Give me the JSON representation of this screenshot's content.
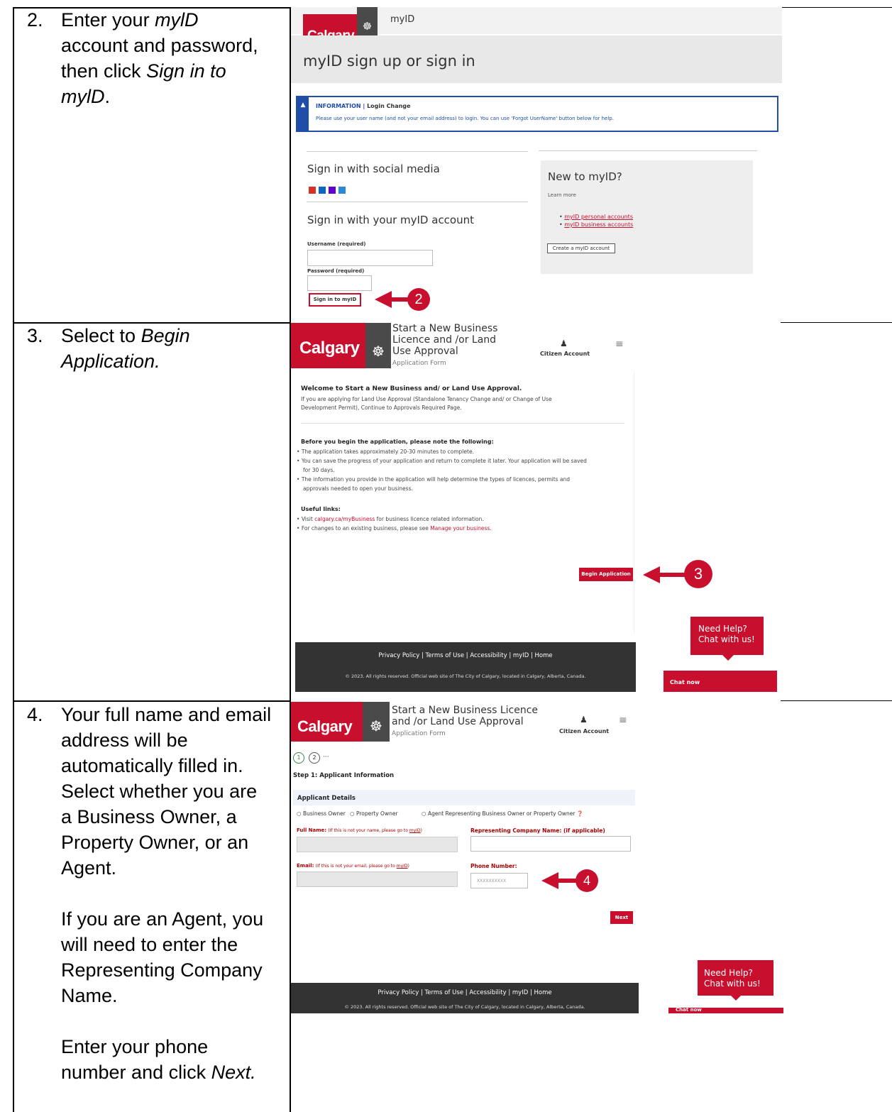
{
  "steps": [
    {
      "num": "2.",
      "lines": [
        [
          "Enter your ",
          "mylD",
          ""
        ],
        [
          "account and password,"
        ],
        [
          "then click ",
          "Sign in to",
          ""
        ],
        [
          "",
          "mylD",
          "."
        ]
      ]
    },
    {
      "num": "3.",
      "lines": [
        [
          "Select to ",
          "Begin",
          ""
        ],
        [
          "",
          "Application.",
          ""
        ]
      ]
    },
    {
      "num": "4.",
      "p1": [
        "Your full name and email",
        "address will be",
        "automatically filled in.",
        "Select whether you are",
        "a Business Owner, a",
        "Property Owner, or an",
        "Agent."
      ],
      "p2": [
        "If you are an Agent, you",
        "will need to enter the",
        "Representing Company",
        "Name."
      ],
      "p3a": "Enter your phone",
      "p3b": "number and click ",
      "p3c": "Next."
    }
  ],
  "s1": {
    "logo": "Calgary",
    "crest": "crest-icon",
    "brand": "myID",
    "heading": "myID sign up or sign in",
    "info_label": "INFORMATION",
    "info_sep": "|",
    "info_title": "Login Change",
    "info_text": "Please use your user name (and not your email address) to login. You can use 'Forgot UserName' button below for help.",
    "social_title": "Sign in with social media",
    "social_icons": [
      "google-icon",
      "linkedin-icon",
      "yahoo-icon",
      "microsoft-icon"
    ],
    "account_title": "Sign in with your myID account",
    "username_label": "Username (required)",
    "password_label": "Password (required)",
    "signin_button": "Sign in to myID",
    "badge": "2",
    "new_title": "New to myID?",
    "learn_more": "Learn more",
    "links": [
      "myID personal accounts",
      "myID business accounts"
    ],
    "create_button": "Create a myID account"
  },
  "s2": {
    "logo": "Calgary",
    "title": [
      "Start a New Business",
      "Licence and /or Land",
      "Use Approval"
    ],
    "subtitle": "Application Form",
    "account": "Citizen Account",
    "welcome": "Welcome to Start a New Business and/ or Land Use Approval.",
    "intro": [
      "If you are applying for Land Use Approval (Standalone Tenancy Change and/ or Change of Use",
      "Development Permit), Continue to Approvals Required Page."
    ],
    "before_title": "Before you begin the application, please note the following:",
    "b1": "The application takes approximately 20-30 minutes to complete.",
    "b2a": "You can save the progress of your application and return to complete it later. Your application will be saved",
    "b2b": "for 30 days.",
    "b3a": "The information you provide in the application will help determine the types of licences, permits and",
    "b3b": "approvals needed to open your business.",
    "useful_title": "Useful links:",
    "u1_pre": "Visit ",
    "u1_link": "calgary.ca/myBusiness",
    "u1_post": " for business licence related information.",
    "u2_pre": "For changes to an existing business, please see ",
    "u2_link": "Manage your business",
    "u2_post": ".",
    "begin_button": "Begin Application",
    "badge": "3",
    "footer_links": "Privacy Policy | Terms of Use | Accessibility | myID | Home",
    "footer_copy": "© 2023. All rights reserved. Official web site of The City of Calgary, located in Calgary, Alberta, Canada.",
    "help": [
      "Need Help?",
      "Chat with us!"
    ],
    "chat_now": "Chat now"
  },
  "s3": {
    "logo": "Calgary",
    "title": [
      "Start a New Business Licence",
      "and /or Land Use Approval"
    ],
    "subtitle": "Application Form",
    "account": "Citizen Account",
    "steps": [
      "1",
      "2",
      "···"
    ],
    "step_title": "Step 1: Applicant Information",
    "section": "Applicant Details",
    "radios": [
      "Business Owner",
      "Property Owner",
      "Agent Representing Business Owner or Property Owner"
    ],
    "fullname_label": "Full Name:",
    "fullname_note": "(If this is not your name, please go to ",
    "myid_link": "myID",
    "note_close": ")",
    "company_label": "Representing Company Name: (if applicable)",
    "email_label": "Email:",
    "email_note": "(If this is not your email, please go to ",
    "phone_label": "Phone Number:",
    "phone_placeholder": "XXXXXXXXXX",
    "next_button": "Next",
    "badge": "4",
    "footer_links": "Privacy Policy | Terms of Use | Accessibility | myID | Home",
    "footer_copy": "© 2023. All rights reserved. Official web site of The City of Calgary, located in Calgary, Alberta, Canada.",
    "help": [
      "Need Help?",
      "Chat with us!"
    ],
    "chat_now": "Chat now"
  }
}
